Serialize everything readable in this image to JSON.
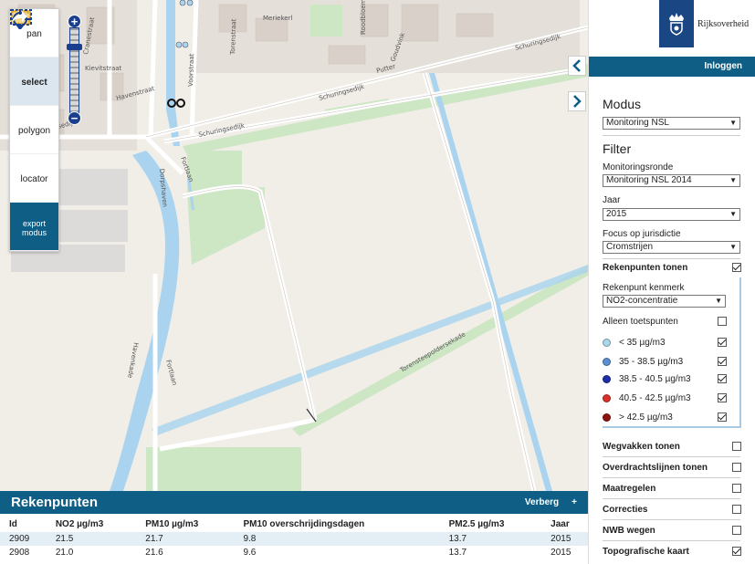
{
  "tools": [
    {
      "label": "pan",
      "icon": "move-arrows-icon",
      "active": false
    },
    {
      "label": "select",
      "icon": "select-box-icon",
      "active": true
    },
    {
      "label": "polygon",
      "icon": "polygon-icon",
      "active": false
    },
    {
      "label": "locator",
      "icon": "crosshair-icon",
      "active": false
    },
    {
      "label": "export modus",
      "icon": "export-arrow-icon",
      "active": false
    }
  ],
  "map": {
    "streets": [
      "Meriekerl",
      "Roodbloem",
      "Cranestraat",
      "Kievitstraat",
      "Havenstraat",
      "Voorstraat",
      "Torenstraat",
      "Goudvink",
      "Schuringsedijk",
      "Schuringsedijk",
      "Putter",
      "Schuringsedijk",
      "Dorpshaven",
      "Fortlaan",
      "Havenkade",
      "Fortlaan",
      "Torensteepoldersekade",
      "Scheuringsedijk"
    ]
  },
  "rekenpunten": {
    "title": "Rekenpunten",
    "hide_label": "Verberg",
    "plus_label": "+",
    "columns": [
      "Id",
      "NO2 µg/m3",
      "PM10 µg/m3",
      "PM10 overschrijdingsdagen",
      "PM2.5 µg/m3",
      "Jaar"
    ],
    "rows": [
      [
        "2909",
        "21.5",
        "21.7",
        "9.8",
        "13.7",
        "2015"
      ],
      [
        "2908",
        "21.0",
        "21.6",
        "9.6",
        "13.7",
        "2015"
      ]
    ]
  },
  "sidebar": {
    "logo_text": "Rijksoverheid",
    "login_label": "Inloggen",
    "modus_title": "Modus",
    "modus_value": "Monitoring NSL",
    "filter_title": "Filter",
    "ronde_label": "Monitoringsronde",
    "ronde_value": "Monitoring NSL 2014",
    "jaar_label": "Jaar",
    "jaar_value": "2015",
    "focus_label": "Focus op jurisdictie",
    "focus_value": "Cromstrijen",
    "rekenpunten_tonen": "Rekenpunten tonen",
    "kenmerk_label": "Rekenpunt kenmerk",
    "kenmerk_value": "NO2-concentratie",
    "toetspunten_label": "Alleen toetspunten",
    "legend": [
      {
        "label": "< 35 µg/m3",
        "color": "#a9d6e8",
        "checked": true
      },
      {
        "label": "35 - 38.5 µg/m3",
        "color": "#5a8fd0",
        "checked": true
      },
      {
        "label": "38.5 - 40.5 µg/m3",
        "color": "#1c2fa8",
        "checked": true
      },
      {
        "label": "40.5 - 42.5 µg/m3",
        "color": "#d8322a",
        "checked": true
      },
      {
        "label": "> 42.5 µg/m3",
        "color": "#8e1410",
        "checked": true
      }
    ],
    "layers": [
      {
        "label": "Wegvakken tonen",
        "checked": false
      },
      {
        "label": "Overdrachtslijnen tonen",
        "checked": false
      },
      {
        "label": "Maatregelen",
        "checked": false
      },
      {
        "label": "Correcties",
        "checked": false
      },
      {
        "label": "NWB wegen",
        "checked": false
      },
      {
        "label": "Topografische kaart",
        "checked": true
      }
    ]
  },
  "colors": {
    "accent": "#0e5e86",
    "water": "#a9d3ee",
    "green": "#cde6c4"
  }
}
